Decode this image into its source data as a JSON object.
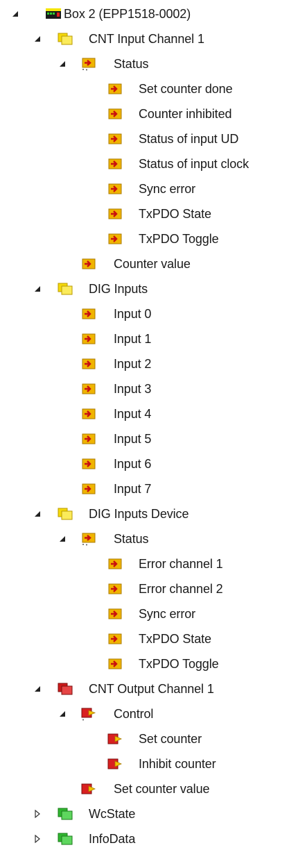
{
  "tree": {
    "colors": {
      "folder_yellow": "#f5d90a",
      "folder_red": "#cc1a1a",
      "folder_green": "#2fb52f",
      "var_input": "#f0b400",
      "var_output": "#d92020"
    },
    "rows": [
      {
        "label": "Box 2 (EPP1518-0002)",
        "level": 0,
        "icon": "device-box-icon",
        "expander": "expanded"
      },
      {
        "label": "CNT Input Channel 1",
        "level": 1,
        "icon": "folder-yellow-icon",
        "expander": "expanded"
      },
      {
        "label": "Status",
        "level": 2,
        "icon": "input-variable-group-icon",
        "expander": "expanded"
      },
      {
        "label": "Set counter done",
        "level": 3,
        "icon": "input-variable-icon",
        "expander": "none"
      },
      {
        "label": "Counter inhibited",
        "level": 3,
        "icon": "input-variable-icon",
        "expander": "none"
      },
      {
        "label": "Status of input UD",
        "level": 3,
        "icon": "input-variable-icon",
        "expander": "none"
      },
      {
        "label": "Status of input clock",
        "level": 3,
        "icon": "input-variable-icon",
        "expander": "none"
      },
      {
        "label": "Sync error",
        "level": 3,
        "icon": "input-variable-icon",
        "expander": "none"
      },
      {
        "label": "TxPDO State",
        "level": 3,
        "icon": "input-variable-icon",
        "expander": "none"
      },
      {
        "label": "TxPDO Toggle",
        "level": 3,
        "icon": "input-variable-icon",
        "expander": "none"
      },
      {
        "label": "Counter value",
        "level": 2,
        "icon": "input-variable-icon",
        "expander": "none"
      },
      {
        "label": "DIG Inputs",
        "level": 1,
        "icon": "folder-yellow-icon",
        "expander": "expanded"
      },
      {
        "label": "Input 0",
        "level": 2,
        "icon": "input-variable-icon",
        "expander": "none"
      },
      {
        "label": "Input 1",
        "level": 2,
        "icon": "input-variable-icon",
        "expander": "none"
      },
      {
        "label": "Input 2",
        "level": 2,
        "icon": "input-variable-icon",
        "expander": "none"
      },
      {
        "label": "Input 3",
        "level": 2,
        "icon": "input-variable-icon",
        "expander": "none"
      },
      {
        "label": "Input 4",
        "level": 2,
        "icon": "input-variable-icon",
        "expander": "none"
      },
      {
        "label": "Input 5",
        "level": 2,
        "icon": "input-variable-icon",
        "expander": "none"
      },
      {
        "label": "Input 6",
        "level": 2,
        "icon": "input-variable-icon",
        "expander": "none"
      },
      {
        "label": "Input 7",
        "level": 2,
        "icon": "input-variable-icon",
        "expander": "none"
      },
      {
        "label": "DIG Inputs Device",
        "level": 1,
        "icon": "folder-yellow-icon",
        "expander": "expanded"
      },
      {
        "label": "Status",
        "level": 2,
        "icon": "input-variable-group-icon",
        "expander": "expanded"
      },
      {
        "label": "Error channel 1",
        "level": 3,
        "icon": "input-variable-icon",
        "expander": "none"
      },
      {
        "label": "Error channel 2",
        "level": 3,
        "icon": "input-variable-icon",
        "expander": "none"
      },
      {
        "label": "Sync error",
        "level": 3,
        "icon": "input-variable-icon",
        "expander": "none"
      },
      {
        "label": "TxPDO State",
        "level": 3,
        "icon": "input-variable-icon",
        "expander": "none"
      },
      {
        "label": "TxPDO Toggle",
        "level": 3,
        "icon": "input-variable-icon",
        "expander": "none"
      },
      {
        "label": "CNT Output Channel 1",
        "level": 1,
        "icon": "folder-red-icon",
        "expander": "expanded"
      },
      {
        "label": "Control",
        "level": 2,
        "icon": "output-variable-group-icon",
        "expander": "expanded"
      },
      {
        "label": "Set counter",
        "level": 3,
        "icon": "output-variable-icon",
        "expander": "none"
      },
      {
        "label": "Inhibit counter",
        "level": 3,
        "icon": "output-variable-icon",
        "expander": "none"
      },
      {
        "label": "Set counter value",
        "level": 2,
        "icon": "output-variable-icon",
        "expander": "none"
      },
      {
        "label": "WcState",
        "level": 1,
        "icon": "folder-green-icon",
        "expander": "collapsed"
      },
      {
        "label": "InfoData",
        "level": 1,
        "icon": "folder-green-icon",
        "expander": "collapsed"
      }
    ]
  }
}
